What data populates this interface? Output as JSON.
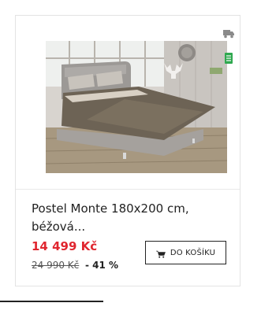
{
  "product": {
    "title": "Postel Monte 180x200 cm, béžová...",
    "price": "14 499 Kč",
    "old_price": "24 990 Kč",
    "discount": "- 41 %",
    "image_icon": "bed-photo",
    "badges": [
      "delivery-truck-icon",
      "in-stock-icon"
    ]
  },
  "cart": {
    "label": "DO KOŠÍKU",
    "icon": "cart-icon"
  },
  "colors": {
    "price": "#e0262f",
    "stock_badge": "#2fa84f",
    "truck_badge": "#8a8a8a",
    "card_border": "#e3e3e3"
  }
}
